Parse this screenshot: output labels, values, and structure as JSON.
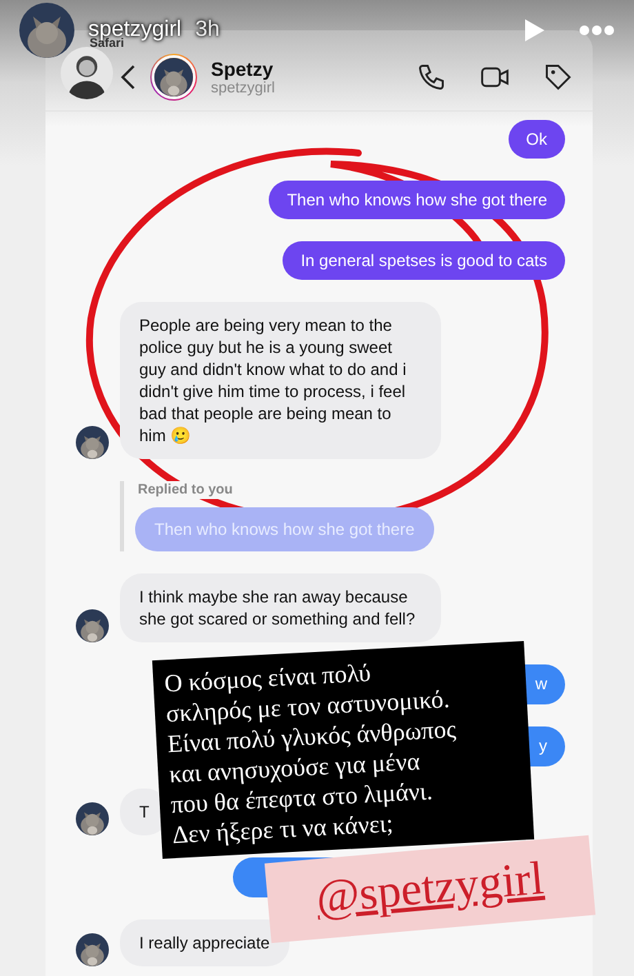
{
  "story": {
    "username": "spetzygirl",
    "time": "3h"
  },
  "screenshot": {
    "status_bar": {
      "app": "Safari"
    },
    "header": {
      "name": "Spetzy",
      "handle": "spetzygirl"
    },
    "messages": [
      {
        "kind": "sent",
        "text": "Ok",
        "color": "#6d45f0"
      },
      {
        "kind": "sent",
        "text": "Then who knows how she got there",
        "color": "#6d45f0"
      },
      {
        "kind": "sent",
        "text": "In general spetses is good to cats",
        "color": "#6d45f0"
      },
      {
        "kind": "received",
        "text": "People are being very mean to the police guy but he is a young sweet guy and didn't know what to do and i didn't give him time to process, i feel bad that people are being mean to him 🥲"
      },
      {
        "kind": "reply",
        "label": "Replied to you",
        "text": "Then who knows how she got there"
      },
      {
        "kind": "received",
        "text": "I think maybe she ran away because she got scared or something and fell?"
      },
      {
        "kind": "sent",
        "text": "w",
        "color": "#3b87f5"
      },
      {
        "kind": "sent",
        "text": "y",
        "color": "#3b87f5"
      },
      {
        "kind": "received",
        "text": "T"
      },
      {
        "kind": "sent",
        "color": "#3b87f5"
      },
      {
        "kind": "received",
        "text": "I really appreciate"
      }
    ]
  },
  "caption": {
    "lines": [
      "Ο κόσμος είναι πολύ",
      "σκληρός με τον αστυνομικό.",
      "Είναι πολύ γλυκός άνθρωπος",
      "και ανησυχούσε για μένα",
      "που θα έπεφτα στο λιμάνι.",
      "Δεν ήξερε τι να κάνει;"
    ]
  },
  "mention": "@spetzygirl"
}
